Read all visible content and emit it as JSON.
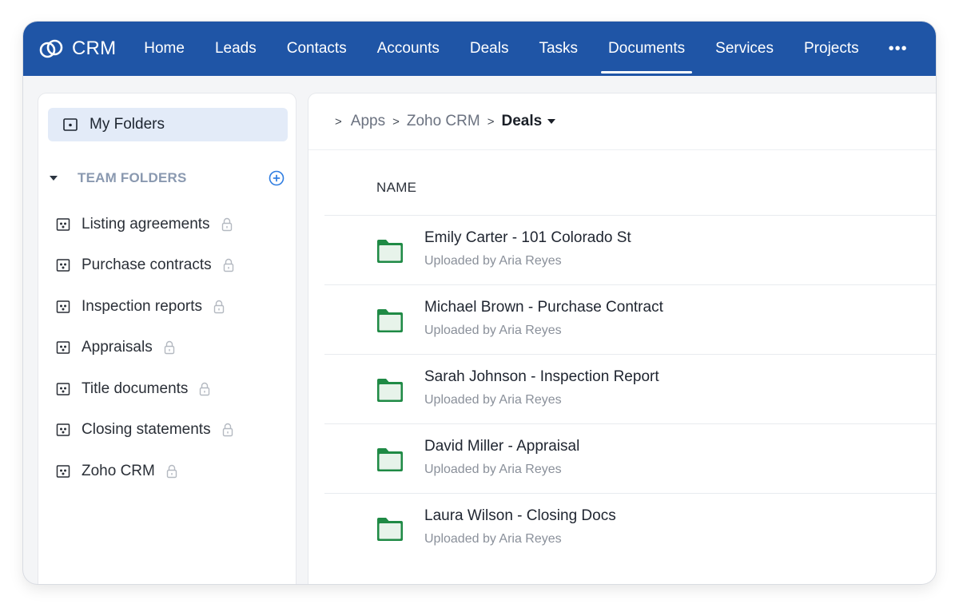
{
  "app": {
    "name": "CRM"
  },
  "nav": {
    "items": [
      {
        "label": "Home",
        "active": false
      },
      {
        "label": "Leads",
        "active": false
      },
      {
        "label": "Contacts",
        "active": false
      },
      {
        "label": "Accounts",
        "active": false
      },
      {
        "label": "Deals",
        "active": false
      },
      {
        "label": "Tasks",
        "active": false
      },
      {
        "label": "Documents",
        "active": true
      },
      {
        "label": "Services",
        "active": false
      },
      {
        "label": "Projects",
        "active": false
      }
    ],
    "more_label": "•••"
  },
  "sidebar": {
    "my_folders_label": "My Folders",
    "team_folders_label": "TEAM FOLDERS",
    "team_folders": [
      {
        "label": "Listing agreements"
      },
      {
        "label": "Purchase contracts"
      },
      {
        "label": "Inspection reports"
      },
      {
        "label": "Appraisals"
      },
      {
        "label": "Title documents"
      },
      {
        "label": "Closing statements"
      },
      {
        "label": "Zoho CRM"
      }
    ]
  },
  "breadcrumb": {
    "items": [
      "Apps",
      "Zoho CRM"
    ],
    "current": "Deals"
  },
  "table": {
    "column_name": "NAME",
    "rows": [
      {
        "title": "Emily Carter - 101 Colorado St",
        "subtitle": "Uploaded by Aria Reyes"
      },
      {
        "title": "Michael Brown - Purchase Contract",
        "subtitle": "Uploaded by Aria Reyes"
      },
      {
        "title": "Sarah Johnson - Inspection Report",
        "subtitle": "Uploaded by Aria Reyes"
      },
      {
        "title": "David Miller - Appraisal",
        "subtitle": "Uploaded by Aria Reyes"
      },
      {
        "title": "Laura Wilson - Closing Docs",
        "subtitle": "Uploaded by Aria Reyes"
      }
    ]
  },
  "colors": {
    "nav_bg": "#1f55a6",
    "accent_blue": "#2f7de1",
    "folder_green": "#1f8a45",
    "selected_bg": "#e3ebf8"
  },
  "icons": {
    "brand": "crm-logo-icon",
    "my_folders": "folder-icon",
    "team_folder": "team-folder-icon",
    "lock": "lock-icon",
    "add": "plus-circle-icon",
    "row_folder": "folder-icon"
  }
}
